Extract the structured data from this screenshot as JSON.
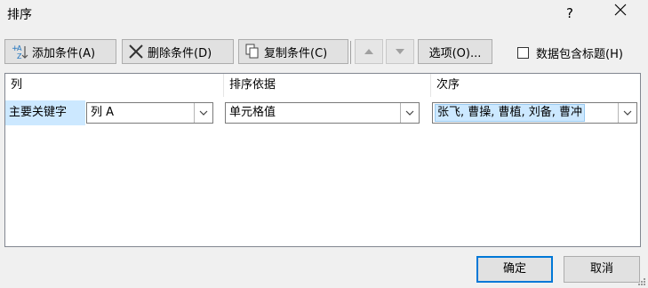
{
  "window": {
    "title": "排序",
    "help_label": "?",
    "close_label": "✕"
  },
  "toolbar": {
    "add_label": "添加条件(A)",
    "delete_label": "删除条件(D)",
    "copy_label": "复制条件(C)",
    "up_label": "▲",
    "down_label": "▼",
    "options_label": "选项(O)...",
    "header_checkbox_label": "数据包含标题(H)",
    "header_checkbox_checked": false
  },
  "grid": {
    "col_header_column": "列",
    "col_header_sorton": "排序依据",
    "col_header_order": "次序",
    "rows": [
      {
        "label": "主要关键字",
        "column": "列 A",
        "sort_on": "单元格值",
        "order": "张飞, 曹操, 曹植, 刘备, 曹冲"
      }
    ]
  },
  "footer": {
    "ok_label": "确定",
    "cancel_label": "取消"
  },
  "colors": {
    "selection": "#cce8ff",
    "default_button_border": "#0078d7",
    "disabled_text": "#a0a0a0"
  }
}
